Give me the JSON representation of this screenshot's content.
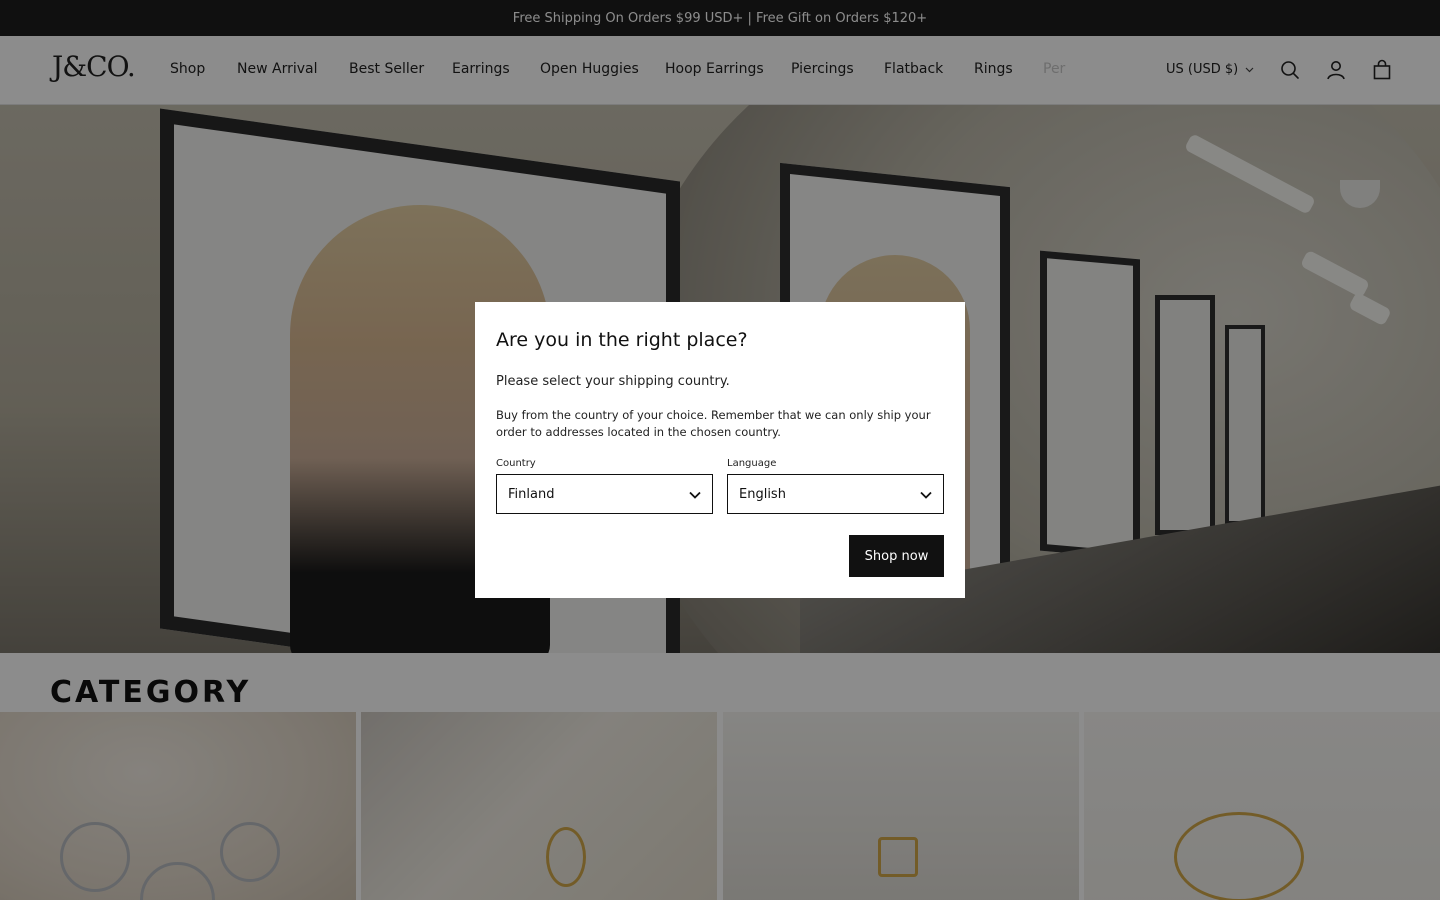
{
  "announcement": "Free Shipping On Orders $99 USD+ | Free Gift on Orders $120+",
  "header": {
    "logo": "J&CO.",
    "nav": [
      "Shop",
      "New Arrival",
      "Best Seller",
      "Earrings",
      "Open Huggies",
      "Hoop Earrings",
      "Piercings",
      "Flatback",
      "Rings",
      "Per"
    ],
    "currency": "US (USD $)",
    "icons": [
      "search-icon",
      "account-icon",
      "cart-icon"
    ]
  },
  "category": {
    "title": "CATEGORY"
  },
  "modal": {
    "title": "Are you in the right place?",
    "subtitle": "Please select your shipping country.",
    "body": "Buy from the country of your choice. Remember that we can only ship your order to addresses located in the chosen country.",
    "country_label": "Country",
    "country_value": "Finland",
    "language_label": "Language",
    "language_value": "English",
    "button": "Shop now"
  },
  "colors": {
    "announcement_bg": "#1e1e1e",
    "button_bg": "#111111",
    "overlay": "rgba(0,0,0,0.45)"
  }
}
